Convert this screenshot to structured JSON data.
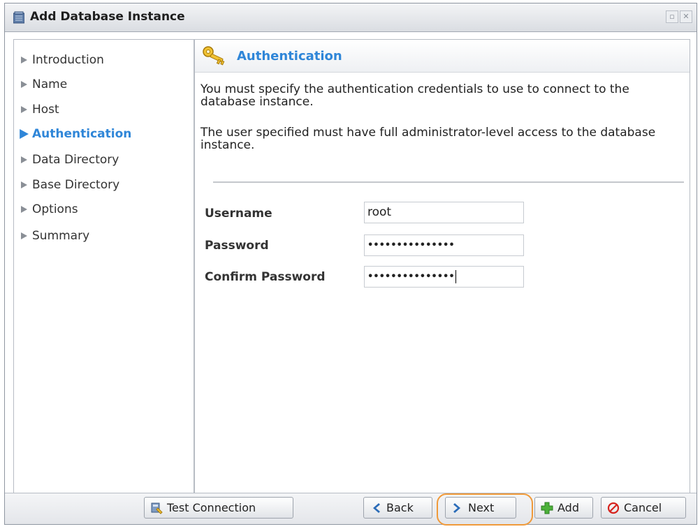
{
  "window": {
    "title": "Add Database Instance"
  },
  "sidebar": {
    "items": [
      {
        "label": "Introduction",
        "active": false
      },
      {
        "label": "Name",
        "active": false
      },
      {
        "label": "Host",
        "active": false
      },
      {
        "label": "Authentication",
        "active": true
      },
      {
        "label": "Data Directory",
        "active": false
      },
      {
        "label": "Base Directory",
        "active": false
      },
      {
        "label": "Options",
        "active": false
      },
      {
        "label": "Summary",
        "active": false
      }
    ]
  },
  "content": {
    "title": "Authentication",
    "para1": "You must specify the authentication credentials to use to connect to the database instance.",
    "para2": "The user specified must have full administrator-level access to the database instance.",
    "fields": {
      "username_label": "Username",
      "username_value": "root",
      "password_label": "Password",
      "password_value": "•••••••••••••••",
      "confirm_label": "Confirm Password",
      "confirm_value": "•••••••••••••••"
    }
  },
  "footer": {
    "test_connection": "Test Connection",
    "back": "Back",
    "next": "Next",
    "add": "Add",
    "cancel": "Cancel"
  },
  "colors": {
    "accent": "#2f86d8",
    "highlight": "#f09a3a"
  }
}
